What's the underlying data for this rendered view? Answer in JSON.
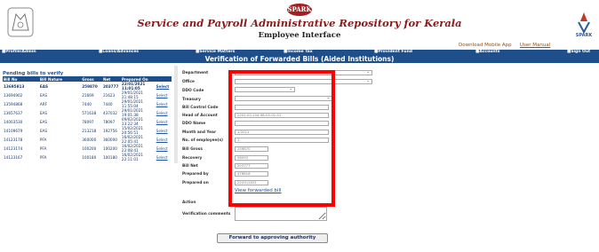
{
  "header": {
    "logo_text": "SPARK",
    "title": "Service and Payroll Administrative Repository for Kerala",
    "subtitle": "Employee Interface",
    "download_app": "Download Mobile App",
    "user_manual": "User Manual"
  },
  "menu": [
    {
      "label": "■Profile/Admin"
    },
    {
      "label": "■Loans/Advances"
    },
    {
      "label": "■Service Matters"
    },
    {
      "label": "■Income Tax"
    },
    {
      "label": "■Provident Fund"
    },
    {
      "label": "■Accounts"
    },
    {
      "label": "■Sign Out"
    }
  ],
  "page_heading": "Verification of Forwarded Bills (Aided Institutions)",
  "pending": {
    "title": "Pending bills to verify",
    "columns": [
      "Bill No",
      "Bill Nature",
      "Gross",
      "Net",
      "Prepared On",
      ""
    ],
    "rows": [
      {
        "bill_no": "13695813",
        "nature": "EAS",
        "gross": "259870",
        "net": "203777",
        "prepared": "22/01/2021 11:01:05",
        "action": "Select"
      },
      {
        "bill_no": "13694902",
        "nature": "EAS",
        "gross": "21669",
        "net": "21623",
        "prepared": "29/01/2021 21:48:15",
        "action": "Select"
      },
      {
        "bill_no": "13594868",
        "nature": "ARF",
        "gross": "7440",
        "net": "7440",
        "prepared": "29/01/2021 11:55:04",
        "action": "Select"
      },
      {
        "bill_no": "13657637",
        "nature": "EAS",
        "gross": "571638",
        "net": "437032",
        "prepared": "29/01/2021 19:01:38",
        "action": "Select"
      },
      {
        "bill_no": "14003530",
        "nature": "EAS",
        "gross": "78097",
        "net": "78097",
        "prepared": "09/02/2021 13:22:34",
        "action": "Select"
      },
      {
        "bill_no": "14109679",
        "nature": "EAS",
        "gross": "213218",
        "net": "192756",
        "prepared": "15/02/2021 20:56:51",
        "action": "Select"
      },
      {
        "bill_no": "14123178",
        "nature": "PFA",
        "gross": "360000",
        "net": "360000",
        "prepared": "16/02/2021 22:05:41",
        "action": "Select"
      },
      {
        "bill_no": "14123174",
        "nature": "PFA",
        "gross": "100200",
        "net": "100200",
        "prepared": "16/02/2021 22:08:41",
        "action": "Select"
      },
      {
        "bill_no": "14123167",
        "nature": "PFA",
        "gross": "100180",
        "net": "100180",
        "prepared": "16/02/2021 22:11:01",
        "action": "Select"
      }
    ]
  },
  "form": {
    "labels": {
      "department": "Department",
      "office": "Office",
      "ddo_code": "DDO Code",
      "treasury": "Treasury",
      "bill_control_code": "Bill Control Code",
      "head_of_account": "Head of Account",
      "ddo_name": "DDO Name",
      "month_year": "Month and Year",
      "no_of_employees": "No. of employee(s)",
      "bill_gross": "Bill Gross",
      "recovery": "Recovery",
      "bill_net": "Bill Net",
      "prepared_by": "Prepared by",
      "prepared_on": "Prepared on",
      "action": "Action",
      "verification_comments": "Verification comments"
    },
    "values": {
      "department": "",
      "office": "",
      "ddo_code": "",
      "treasury": "",
      "bill_control_code": "",
      "head_of_account": "2202-02-104-98-05-01-01",
      "ddo_name": "",
      "month_year": "1/2021",
      "no_of_employees": "1",
      "bill_gross": "259870",
      "recovery": "56093",
      "bill_net": "203777",
      "prepared_by": "476818",
      "prepared_on": "22/01/2021"
    },
    "view_link": "View forwarded bill",
    "forward_button": "Forward to approving authority"
  }
}
